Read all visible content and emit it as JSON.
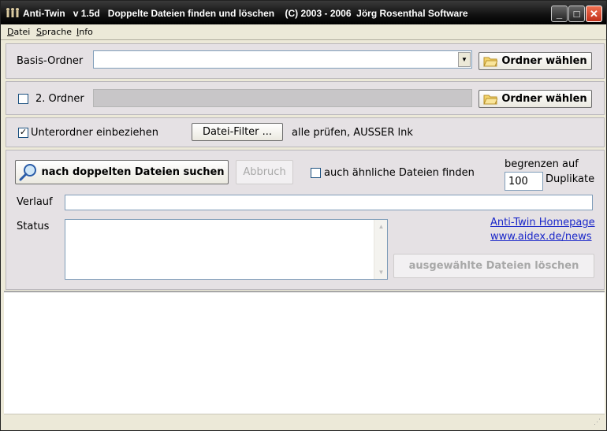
{
  "title": {
    "text": "Anti-Twin   v 1.5d   Doppelte Dateien finden und löschen    (C) 2003 - 2006  Jörg Rosenthal Software"
  },
  "menu": [
    "Datei",
    "Sprache",
    "Info"
  ],
  "basis": {
    "label": "Basis-Ordner",
    "value": "",
    "button": "Ordner wählen"
  },
  "second": {
    "label": "2. Ordner",
    "checked": false,
    "button": "Ordner wählen"
  },
  "subfolder": {
    "label": "Unterordner einbeziehen",
    "checked": true,
    "filter_button": "Datei-Filter ...",
    "filter_info": "alle prüfen, AUSSER lnk"
  },
  "search": {
    "button": "nach doppelten Dateien suchen",
    "abort": "Abbruch",
    "similar_label": "auch ähnliche Dateien finden",
    "similar_checked": false,
    "limit_label": "begrenzen auf",
    "limit_value": "100",
    "limit_suffix": "Duplikate"
  },
  "progress": {
    "label": "Verlauf",
    "value": ""
  },
  "status": {
    "label": "Status",
    "text": ""
  },
  "links": {
    "homepage": "Anti-Twin Homepage",
    "news": "www.aidex.de/news"
  },
  "delete_button": "ausgewählte Dateien löschen",
  "icons": {
    "app": "app-people-icon",
    "folder": "folder-icon",
    "magnifier": "magnifier-icon"
  },
  "colors": {
    "link": "#1a27c9",
    "panel": "#e5e1e4",
    "titlebar": "#111111",
    "close": "#c0301a"
  }
}
